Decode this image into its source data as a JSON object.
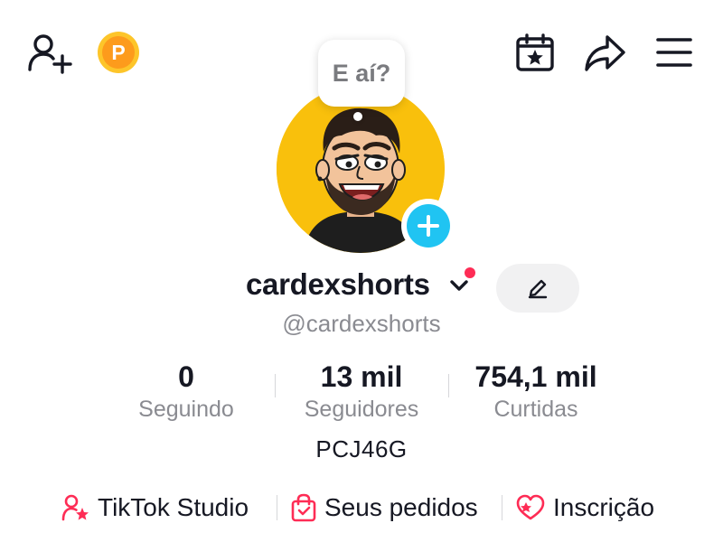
{
  "speech_bubble": {
    "text": "E aí?"
  },
  "profile": {
    "display_name": "cardexshorts",
    "handle": "@cardexshorts",
    "bio": "PCJ46G"
  },
  "stats": [
    {
      "value": "0",
      "label": "Seguindo"
    },
    {
      "value": "13 mil",
      "label": "Seguidores"
    },
    {
      "value": "754,1 mil",
      "label": "Curtidas"
    }
  ],
  "links": [
    {
      "label": "TikTok Studio",
      "icon": "person-star-icon"
    },
    {
      "label": "Seus pedidos",
      "icon": "shopping-bag-icon"
    },
    {
      "label": "Inscrição",
      "icon": "heart-star-icon"
    }
  ],
  "topbar": {
    "coin_letter": "P",
    "icons": [
      "add-friend-icon",
      "coin-icon",
      "calendar-star-icon",
      "share-icon",
      "menu-icon"
    ]
  },
  "colors": {
    "accent_red": "#fe2c55",
    "avatar_bg": "#f9c00c",
    "plus_blue": "#20c4f2",
    "coin_orange": "#fd9b1c"
  }
}
